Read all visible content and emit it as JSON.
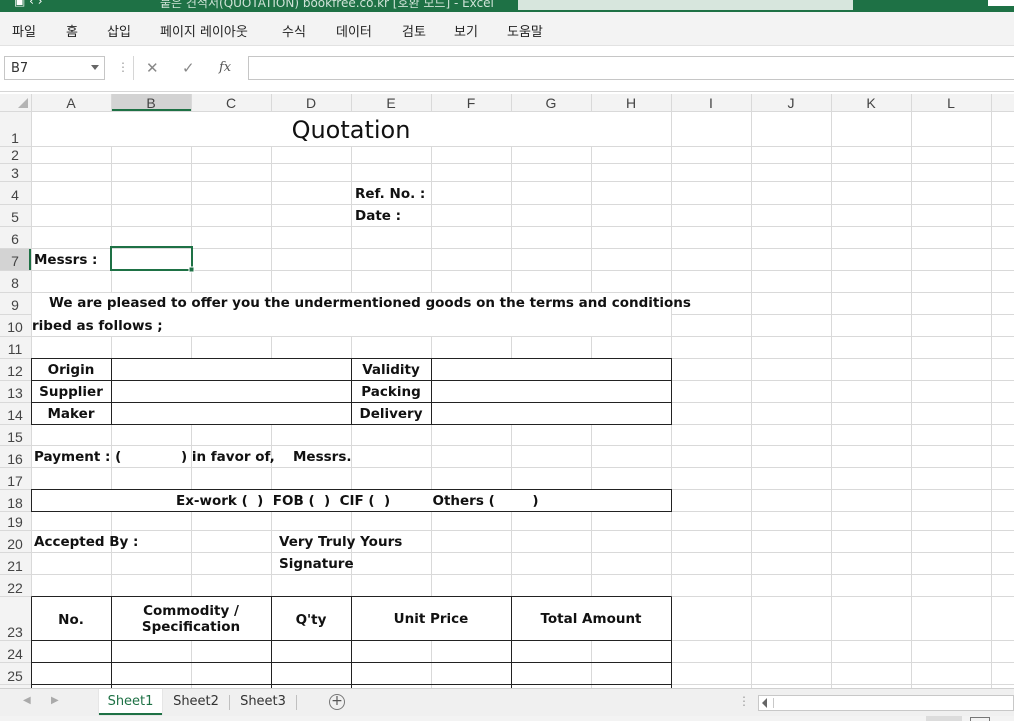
{
  "titlebar": {
    "text": "붙은 견적서(QUOTATION) bookfree.co.kr  [호환 모드]  -  Excel",
    "colors": {
      "accent": "#1e7145"
    }
  },
  "menu": [
    "파일",
    "홈",
    "삽입",
    "페이지 레이아웃",
    "수식",
    "데이터",
    "검토",
    "보기",
    "도움말"
  ],
  "formula_bar": {
    "name_box": "B7",
    "cancel_icon": "✕",
    "enter_icon": "✓",
    "fx_label": "fx",
    "value": ""
  },
  "columns": [
    "A",
    "B",
    "C",
    "D",
    "E",
    "F",
    "G",
    "H",
    "I",
    "J",
    "K",
    "L"
  ],
  "rows": [
    "1",
    "2",
    "3",
    "4",
    "5",
    "6",
    "7",
    "8",
    "9",
    "10",
    "11",
    "12",
    "13",
    "14",
    "15",
    "16",
    "17",
    "18",
    "19",
    "20",
    "21",
    "22",
    "23",
    "24",
    "25"
  ],
  "selected_cell": "B7",
  "sheet": {
    "title": "Quotation",
    "ref_no": "Ref. No. :",
    "date": "Date :",
    "messrs": "Messrs :",
    "intro_line1": "We are pleased to offer you the undermentioned goods on the terms and conditions",
    "intro_line2": "ribed as follows ;",
    "origin": "Origin",
    "supplier": "Supplier",
    "maker": "Maker",
    "validity": "Validity",
    "packing": "Packing",
    "delivery": "Delivery",
    "payment": "Payment : (",
    "payment_close": ") in favor of,",
    "payment_messrs": "Messrs.",
    "terms": "Ex-work (  )  FOB (  )  CIF (  )         Others (        )",
    "accepted_by": "Accepted By :",
    "very_truly": "Very Truly Yours",
    "signature": "Signature",
    "table_headers": {
      "no": "No.",
      "commodity_line1": "Commodity /",
      "commodity_line2": "Specification",
      "qty": "Q'ty",
      "unit_price": "Unit Price",
      "total_amount": "Total Amount"
    }
  },
  "sheet_tabs": [
    {
      "label": "Sheet1",
      "active": true
    },
    {
      "label": "Sheet2",
      "active": false
    },
    {
      "label": "Sheet3",
      "active": false
    }
  ],
  "add_sheet": "+"
}
